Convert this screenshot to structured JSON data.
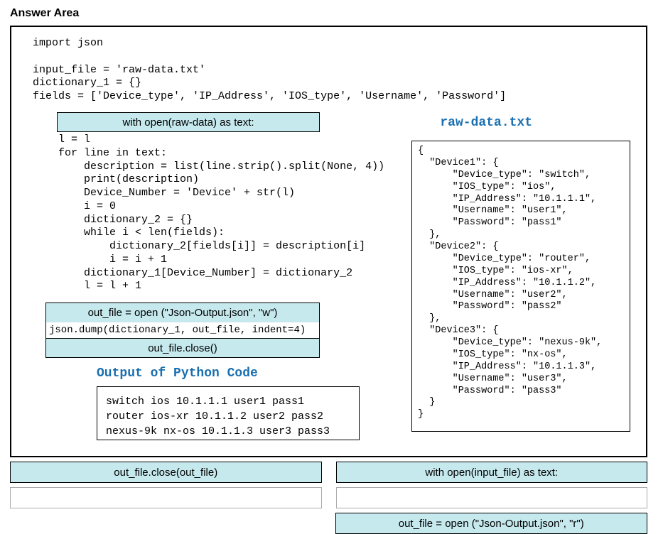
{
  "title": "Answer Area",
  "code_top": "import json\n\ninput_file = 'raw-data.txt'\ndictionary_1 = {}\nfields = ['Device_type', 'IP_Address', 'IOS_type', 'Username', 'Password']",
  "slot1_text": "with open(raw-data) as text:",
  "code_mid": "    l = l\n    for line in text:\n        description = list(line.strip().split(None, 4))\n        print(description)\n        Device_Number = 'Device' + str(l)\n        i = 0\n        dictionary_2 = {}\n        while i < len(fields):\n            dictionary_2[fields[i]] = description[i]\n            i = i + 1\n        dictionary_1[Device_Number] = dictionary_2\n        l = l + 1",
  "slot2_text": "out_file = open (\"Json-Output.json\", \"w\")",
  "dump_line": "json.dump(dictionary_1, out_file, indent=4)",
  "slot3_text": "out_file.close()",
  "raw_title": "raw-data.txt",
  "raw_content": "{\n  \"Device1\": {\n      \"Device_type\": \"switch\",\n      \"IOS_type\": \"ios\",\n      \"IP_Address\": \"10.1.1.1\",\n      \"Username\": \"user1\",\n      \"Password\": \"pass1\"\n  },\n  \"Device2\": {\n      \"Device_type\": \"router\",\n      \"IOS_type\": \"ios-xr\",\n      \"IP_Address\": \"10.1.1.2\",\n      \"Username\": \"user2\",\n      \"Password\": \"pass2\"\n  },\n  \"Device3\": {\n      \"Device_type\": \"nexus-9k\",\n      \"IOS_type\": \"nx-os\",\n      \"IP_Address\": \"10.1.1.3\",\n      \"Username\": \"user3\",\n      \"Password\": \"pass3\"\n  }\n}",
  "py_out_title": "Output of Python Code",
  "py_out_content": "switch ios 10.1.1.1 user1 pass1\nrouter ios-xr 10.1.1.2 user2 pass2\nnexus-9k nx-os 10.1.1.3 user3 pass3",
  "bottom": {
    "left1": "out_file.close(out_file)",
    "right1": "with open(input_file) as text:",
    "right2": "out_file = open (\"Json-Output.json\", \"r\")"
  }
}
